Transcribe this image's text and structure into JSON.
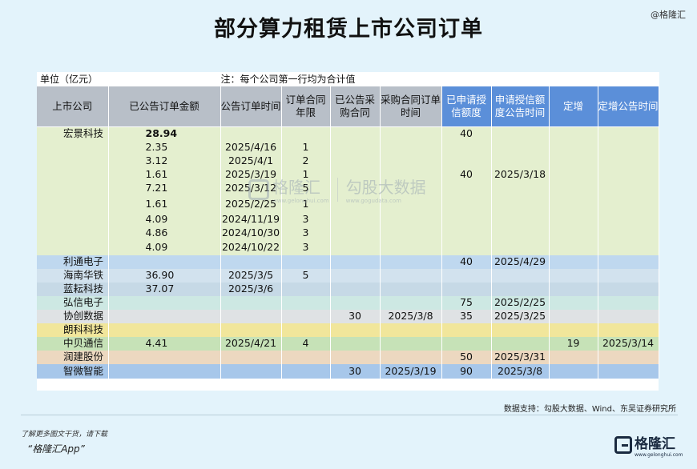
{
  "title": "部分算力租赁上市公司订单",
  "handle": "@格隆汇",
  "unit_label": "单位（亿元）",
  "unit_note": "注：每个公司第一行均为合计值",
  "headers": [
    "上市公司",
    "已公告订单金额",
    "公告订单时间",
    "订单合同年限",
    "已公告采购合同",
    "采购合同订单时间",
    "已申请授信额度",
    "申请授信额度公告时间",
    "定增",
    "定增公告时间"
  ],
  "rows": {
    "hongjing": {
      "company": "宏景科技",
      "amount": "28.94",
      "credit": "40"
    },
    "hj1": {
      "amount": "2.35",
      "date": "2025/4/16",
      "years": "1"
    },
    "hj2": {
      "amount": "3.12",
      "date": "2025/4/1",
      "years": "2"
    },
    "hj3": {
      "amount": "1.61",
      "date": "2025/3/19",
      "years": "1",
      "credit": "40",
      "credit_date": "2025/3/18"
    },
    "hj4": {
      "amount": "7.21",
      "date": "2025/3/12",
      "years": "5"
    },
    "hj5": {
      "amount": "1.61",
      "date": "2025/2/25",
      "years": "1"
    },
    "hj6": {
      "amount": "4.09",
      "date": "2024/11/19",
      "years": "3"
    },
    "hj7": {
      "amount": "4.86",
      "date": "2024/10/30",
      "years": "3"
    },
    "hj8": {
      "amount": "4.09",
      "date": "2024/10/22",
      "years": "3"
    },
    "litong": {
      "company": "利通电子",
      "credit": "40",
      "credit_date": "2025/4/29"
    },
    "hainan": {
      "company": "海南华铁",
      "amount": "36.90",
      "date": "2025/3/5",
      "years": "5"
    },
    "lanyun": {
      "company": "蓝耘科技",
      "amount": "37.07",
      "date": "2025/3/6"
    },
    "hongxin": {
      "company": "弘信电子",
      "credit": "75",
      "credit_date": "2025/2/25"
    },
    "xiechuang": {
      "company": "协创数据",
      "purchase": "30",
      "purchase_date": "2025/3/8",
      "credit": "35",
      "credit_date": "2025/3/25"
    },
    "langke": {
      "company": "朗科科技"
    },
    "zhongbei": {
      "company": "中贝通信",
      "amount": "4.41",
      "date": "2025/4/21",
      "years": "4",
      "placement": "19",
      "placement_date": "2025/3/14"
    },
    "runjian": {
      "company": "润建股份",
      "credit": "50",
      "credit_date": "2025/3/31"
    },
    "zhiwei": {
      "company": "智微智能",
      "purchase": "30",
      "purchase_date": "2025/3/19",
      "credit": "90",
      "credit_date": "2025/3/8"
    }
  },
  "watermark": {
    "brand": "格隆汇",
    "brand_sub": "www.gelonghui.com",
    "partner": "勾股大数据",
    "partner_sub": "www.gogudata.com"
  },
  "source": "数据支持：勾股大数据、Wind、东吴证券研究所",
  "promo_line1": "了解更多图文干货，请下载",
  "promo_line2": "“格隆汇App”",
  "logo_text": "格隆汇",
  "logo_sub": "www.gelonghui.com",
  "colors": {
    "background": "#e3f3fb",
    "header_gray": "#b8bfc8",
    "header_blue": "#5b8fd9"
  }
}
